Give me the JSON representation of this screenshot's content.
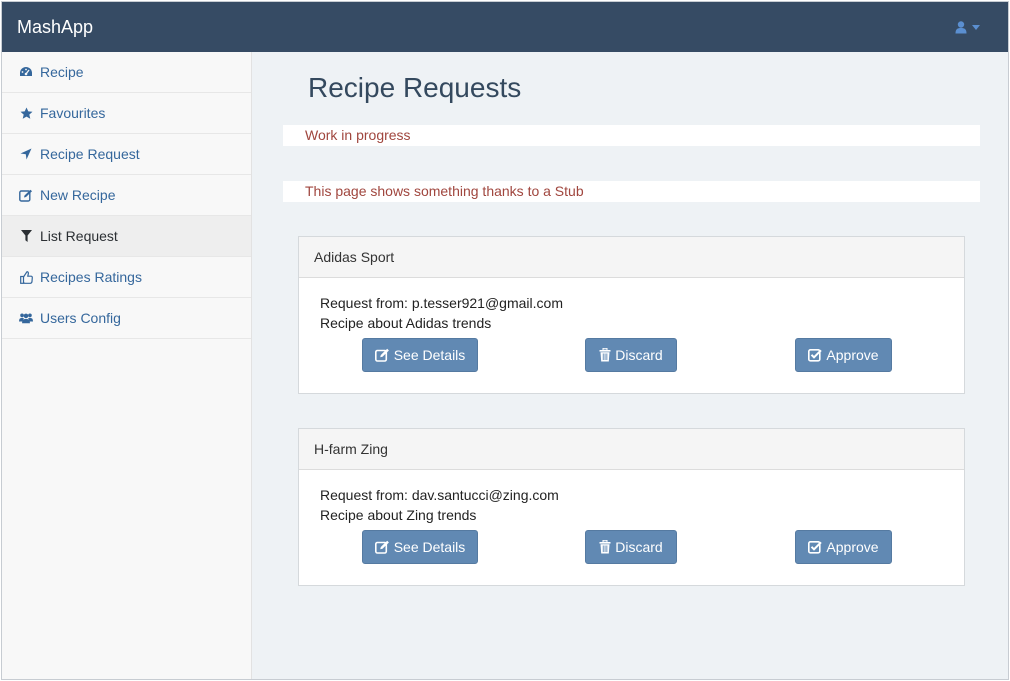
{
  "app": {
    "brand": "MashApp"
  },
  "navbar": {
    "user_icon": "user-icon",
    "caret_icon": "caret-down-icon"
  },
  "sidebar": {
    "items": [
      {
        "label": "Recipe",
        "icon": "dashboard-icon"
      },
      {
        "label": "Favourites",
        "icon": "star-icon"
      },
      {
        "label": "Recipe Request",
        "icon": "location-arrow-icon"
      },
      {
        "label": "New Recipe",
        "icon": "edit-icon"
      },
      {
        "label": "List Request",
        "icon": "filter-icon",
        "active": true
      },
      {
        "label": "Recipes Ratings",
        "icon": "thumbs-up-icon"
      },
      {
        "label": "Users Config",
        "icon": "users-icon"
      }
    ]
  },
  "main": {
    "title": "Recipe Requests",
    "notices": [
      "Work in progress",
      "This page shows something thanks to a Stub"
    ],
    "requests": [
      {
        "name": "Adidas Sport",
        "from": "Request from: p.tesser921@gmail.com",
        "about": "Recipe about Adidas trends"
      },
      {
        "name": "H-farm Zing",
        "from": "Request from: dav.santucci@zing.com",
        "about": "Recipe about Zing trends"
      }
    ],
    "buttons": {
      "details": "See Details",
      "discard": "Discard",
      "approve": "Approve"
    }
  },
  "colors": {
    "navbar": "#364b64",
    "link": "#35679c",
    "button": "#6189b3",
    "notice_text": "#a0463e",
    "content_bg": "#eef2f5"
  }
}
